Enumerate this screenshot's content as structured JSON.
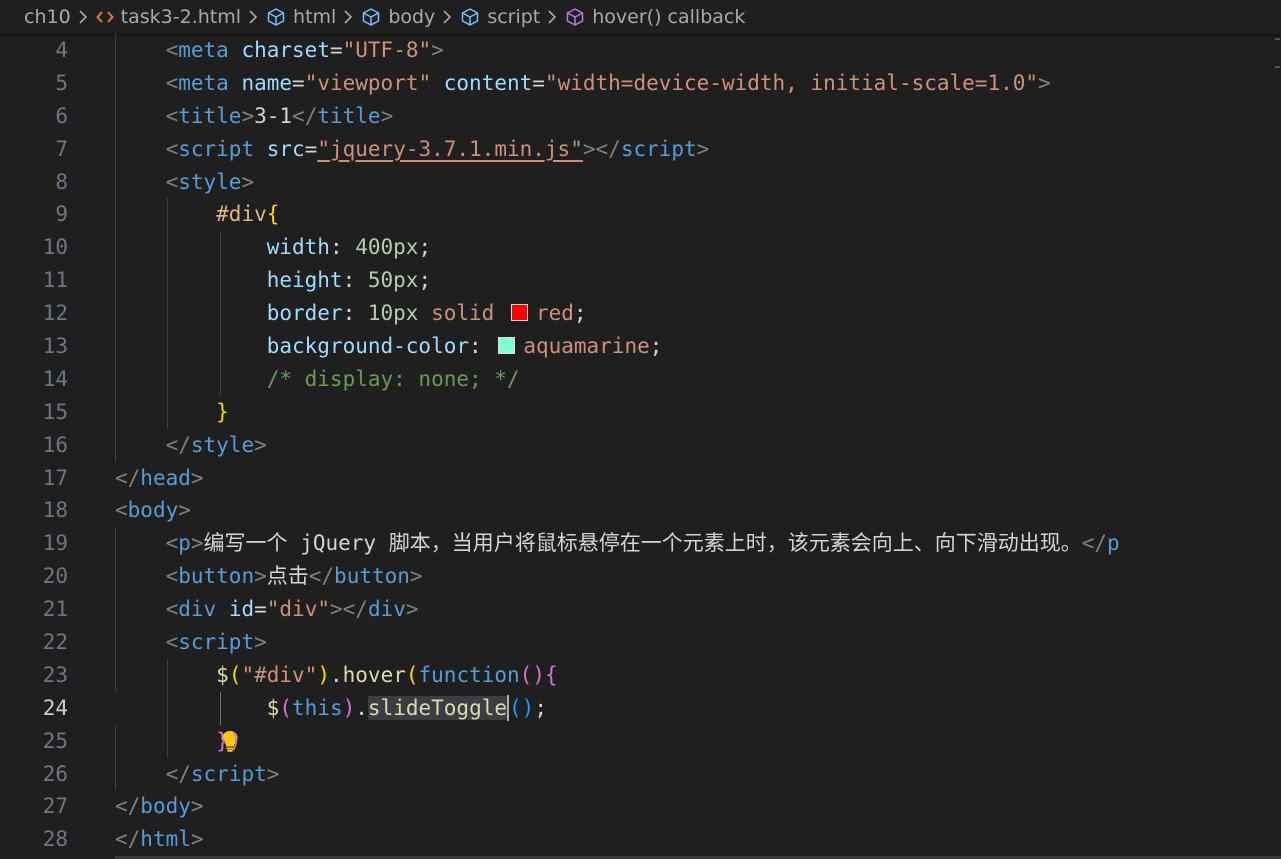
{
  "breadcrumbs": [
    {
      "label": "ch10",
      "icon": ""
    },
    {
      "label": "task3-2.html",
      "icon": "html-file-icon"
    },
    {
      "label": "html",
      "icon": "symbol-element-icon"
    },
    {
      "label": "body",
      "icon": "symbol-element-icon"
    },
    {
      "label": "script",
      "icon": "symbol-element-icon"
    },
    {
      "label": "hover() callback",
      "icon": "symbol-method-icon"
    }
  ],
  "colors": {
    "background": "#1f1f1f",
    "swatch_red": "#ff0000",
    "swatch_aquamarine": "#7fffd4"
  },
  "editor": {
    "active_line": "24",
    "lines": {
      "l4": {
        "num": "4",
        "a": "<",
        "b": "meta",
        "c": " charset",
        "d": "=",
        "e": "\"UTF-8\"",
        "f": ">"
      },
      "l5": {
        "num": "5",
        "a": "<",
        "b": "meta",
        "c": " name",
        "d": "=",
        "e": "\"viewport\"",
        "c2": " content",
        "d2": "=",
        "e2": "\"width=device-width, initial-scale=1.0\"",
        "f": ">"
      },
      "l6": {
        "num": "6",
        "a": "<",
        "b": "title",
        "f": ">",
        "t": "3-1",
        "a2": "</",
        "b2": "title",
        "f2": ">"
      },
      "l7": {
        "num": "7",
        "a": "<",
        "b": "script",
        "c": " src",
        "d": "=",
        "q1": "\"",
        "e": "jquery-3.7.1.min.js",
        "q2": "\"",
        "f": ">",
        "a2": "</",
        "b2": "script",
        "f2": ">"
      },
      "l8": {
        "num": "8",
        "a": "<",
        "b": "style",
        "f": ">"
      },
      "l9": {
        "num": "9",
        "s": "#div",
        "p": "{"
      },
      "l10": {
        "num": "10",
        "k": "width",
        "c": ": ",
        "v": "400px",
        "e": ";"
      },
      "l11": {
        "num": "11",
        "k": "height",
        "c": ": ",
        "v": "50px",
        "e": ";"
      },
      "l12": {
        "num": "12",
        "k": "border",
        "c": ": ",
        "v": "10px",
        "w": " solid ",
        "v2": "red",
        "e": ";"
      },
      "l13": {
        "num": "13",
        "k": "background-color",
        "c": ": ",
        "v2": "aquamarine",
        "e": ";"
      },
      "l14": {
        "num": "14",
        "cm": "/* display: none; */"
      },
      "l15": {
        "num": "15",
        "p": "}"
      },
      "l16": {
        "num": "16",
        "a": "</",
        "b": "style",
        "f": ">"
      },
      "l17": {
        "num": "17",
        "a": "</",
        "b": "head",
        "f": ">"
      },
      "l18": {
        "num": "18",
        "a": "<",
        "b": "body",
        "f": ">"
      },
      "l19": {
        "num": "19",
        "a": "<",
        "b": "p",
        "f": ">",
        "t": "编写一个 jQuery 脚本，当用户将鼠标悬停在一个元素上时，该元素会向上、向下滑动出现。",
        "a2": "</",
        "b2": "p"
      },
      "l20": {
        "num": "20",
        "a": "<",
        "b": "button",
        "f": ">",
        "t": "点击",
        "a2": "</",
        "b2": "button",
        "f2": ">"
      },
      "l21": {
        "num": "21",
        "a": "<",
        "b": "div",
        "c": " id",
        "d": "=",
        "e": "\"div\"",
        "f": ">",
        "a2": "</",
        "b2": "div",
        "f2": ">"
      },
      "l22": {
        "num": "22",
        "a": "<",
        "b": "script",
        "f": ">"
      },
      "l23": {
        "num": "23",
        "dl": "$",
        "p1": "(",
        "s": "\"#div\"",
        "p2": ")",
        "dot": ".",
        "fn": "hover",
        "p3": "(",
        "kw": "function",
        "p4": "(){"
      },
      "l24": {
        "num": "24",
        "dl": "$",
        "p1": "(",
        "kw": "this",
        "p2": ")",
        "dot": ".",
        "fn_a": "slideToggl",
        "fn_b": "e",
        "p3": "()",
        "e": ";"
      },
      "l25": {
        "num": "25",
        "p": "})"
      },
      "l26": {
        "num": "26",
        "a": "</",
        "b": "script",
        "f": ">"
      },
      "l27": {
        "num": "27",
        "a": "</",
        "b": "body",
        "f": ">"
      },
      "l28": {
        "num": "28",
        "a": "</",
        "b": "html",
        "f": ">"
      }
    }
  }
}
